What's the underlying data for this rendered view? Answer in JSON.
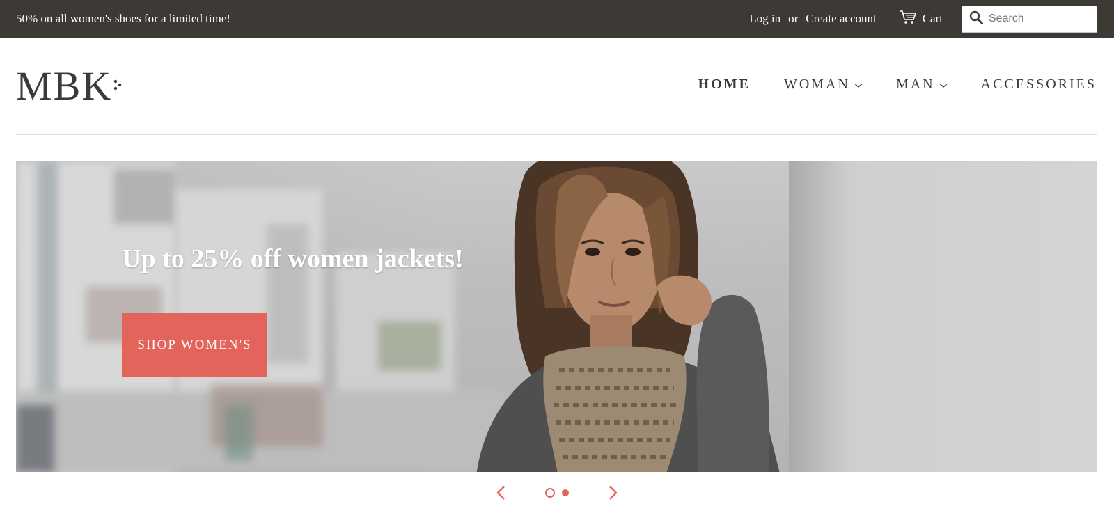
{
  "announcement": {
    "text": "50% on all women's shoes for a limited time!"
  },
  "account": {
    "login_label": "Log in",
    "or_label": "or",
    "create_account_label": "Create account",
    "cart_label": "Cart"
  },
  "search": {
    "placeholder": "Search",
    "value": ""
  },
  "logo": {
    "text": "MBK"
  },
  "nav": {
    "items": [
      {
        "label": "HOME",
        "active": true
      },
      {
        "label": "WOMAN",
        "has_dropdown": true
      },
      {
        "label": "MAN",
        "has_dropdown": true
      },
      {
        "label": "ACCESSORIES"
      }
    ]
  },
  "hero": {
    "title": "Up to 25% off women jackets!",
    "button_label": "SHOP WOMEN'S"
  },
  "slider": {
    "slide_count": 2,
    "active_index": 0
  },
  "colors": {
    "topbar_bg": "#3d3935",
    "accent": "#e2645a",
    "text": "#3d3935"
  },
  "icons": {
    "cart": "cart-icon",
    "search": "search-icon",
    "dropdown": "chevron-down-icon",
    "prev": "chevron-left-icon",
    "next": "chevron-right-icon"
  }
}
